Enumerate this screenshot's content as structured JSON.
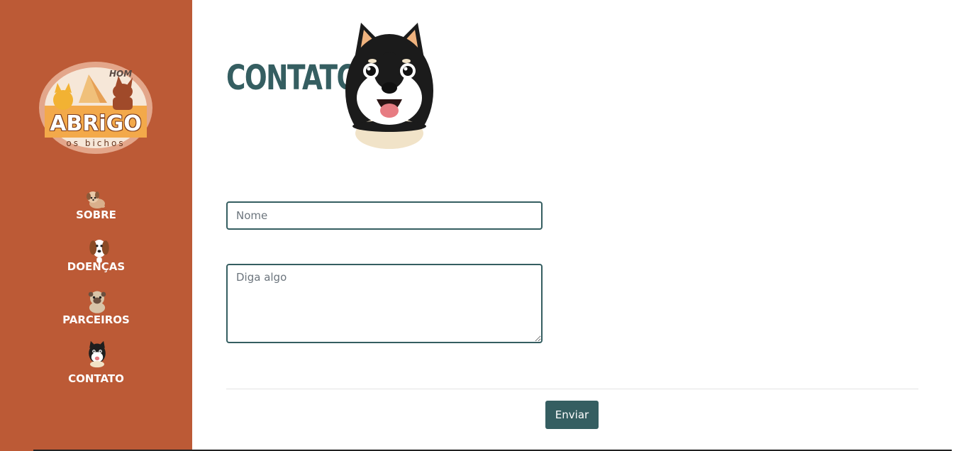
{
  "sidebar": {
    "logo": {
      "title": "ABRiGO",
      "subtitle": "os bichos",
      "corner_text": "HOM",
      "ring_color": "#e8a98a",
      "fill_color": "#f3a94a"
    },
    "items": [
      {
        "label": "SOBRE",
        "icon": "puppy-icon"
      },
      {
        "label": "DOENÇAS",
        "icon": "beagle-icon"
      },
      {
        "label": "PARCEIROS",
        "icon": "pug-icon"
      },
      {
        "label": "CONTATO",
        "icon": "shiba-icon"
      }
    ]
  },
  "main": {
    "title": "CONTATO",
    "title_icon": "shiba-dog-icon",
    "form": {
      "name_placeholder": "Nome",
      "name_value": "",
      "message_placeholder": "Diga algo",
      "message_value": "",
      "submit_label": "Enviar"
    }
  },
  "colors": {
    "sidebar_bg": "#bc5a36",
    "accent": "#355e61",
    "text_light": "#ffffff"
  }
}
